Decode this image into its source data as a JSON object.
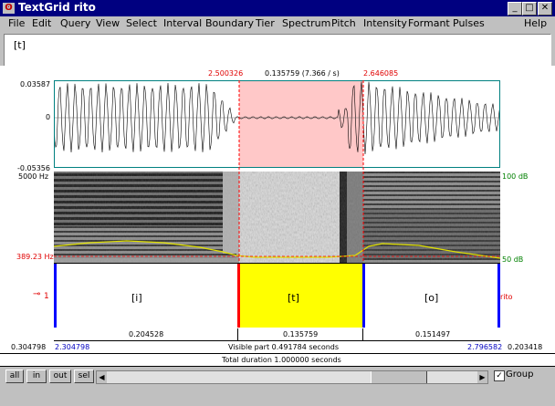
{
  "window": {
    "title": "TextGrid rito",
    "buttons": [
      "_",
      "□",
      "✕"
    ]
  },
  "menu": [
    "File",
    "Edit",
    "Query",
    "View",
    "Select",
    "Interval",
    "Boundary",
    "Tier",
    "Spectrum",
    "Pitch",
    "Intensity",
    "Formant",
    "Pulses",
    "Help"
  ],
  "edit_text": "[t]",
  "selection": {
    "start": "2.500326",
    "duration": "0.135759 (7.366 / s)",
    "end": "2.646085"
  },
  "waveform": {
    "max": "0.03587",
    "zero": "0",
    "min": "-0.05356"
  },
  "spectrogram": {
    "max_freq": "5000 Hz",
    "pitch_cursor": "389.23 Hz",
    "db_high": "100 dB",
    "db_low": "50 dB"
  },
  "tier": {
    "number": "1",
    "name": "rito",
    "intervals": [
      {
        "text": "[i]",
        "duration": "0.204528"
      },
      {
        "text": "[t]",
        "duration": "0.135759"
      },
      {
        "text": "[o]",
        "duration": "0.151497"
      }
    ]
  },
  "bottom": {
    "left_time": "0.304798",
    "visible_start": "2.304798",
    "visible_part": "Visible part 0.491784 seconds",
    "visible_end": "2.796582",
    "right_time": "0.203418",
    "total": "Total duration 1.000000 seconds"
  },
  "buttons": {
    "all": "all",
    "in": "in",
    "out": "out",
    "sel": "sel",
    "group": "Group"
  },
  "colors": {
    "title_bg": "#000080",
    "selection": "#ffc8c8",
    "interval_selected": "#ffff00",
    "boundary": "#0000ff",
    "cursor": "#ff0000",
    "waveform_frame": "#008080"
  }
}
